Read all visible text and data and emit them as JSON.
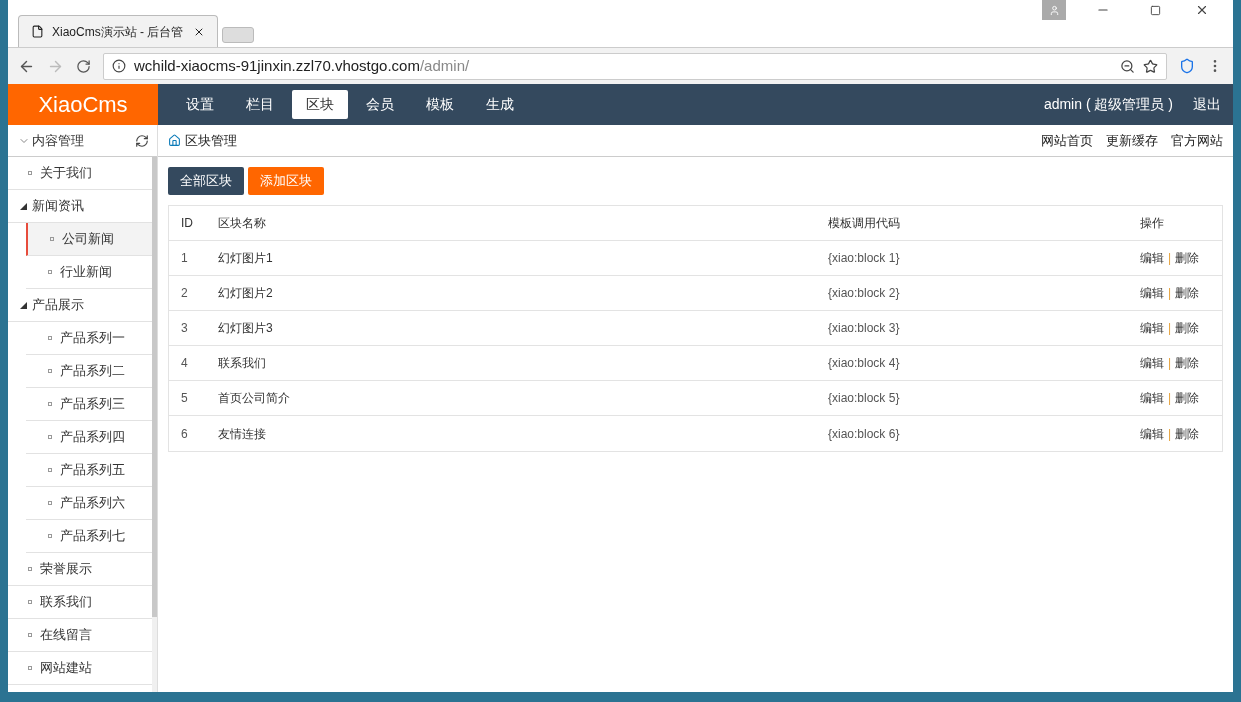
{
  "browser": {
    "tab_title": "XiaoCms演示站 - 后台管",
    "url_host": "wchild-xiaocms-91jinxin.zzl70.vhostgo.com",
    "url_path": "/admin/"
  },
  "header": {
    "logo": "XiaoCms",
    "nav": [
      {
        "label": "设置",
        "selected": false
      },
      {
        "label": "栏目",
        "selected": false
      },
      {
        "label": "区块",
        "selected": true
      },
      {
        "label": "会员",
        "selected": false
      },
      {
        "label": "模板",
        "selected": false
      },
      {
        "label": "生成",
        "selected": false
      }
    ],
    "user": "admin ( 超级管理员 )",
    "logout": "退出"
  },
  "sidebar": {
    "title": "内容管理",
    "items": [
      {
        "label": "关于我们",
        "selected": false
      },
      {
        "label": "新闻资讯",
        "selected": false,
        "expanded": true,
        "children": [
          {
            "label": "公司新闻",
            "selected": true
          },
          {
            "label": "行业新闻",
            "selected": false
          }
        ]
      },
      {
        "label": "产品展示",
        "selected": false,
        "expanded": true,
        "children": [
          {
            "label": "产品系列一",
            "selected": false
          },
          {
            "label": "产品系列二",
            "selected": false
          },
          {
            "label": "产品系列三",
            "selected": false
          },
          {
            "label": "产品系列四",
            "selected": false
          },
          {
            "label": "产品系列五",
            "selected": false
          },
          {
            "label": "产品系列六",
            "selected": false
          },
          {
            "label": "产品系列七",
            "selected": false
          }
        ]
      },
      {
        "label": "荣誉展示",
        "selected": false
      },
      {
        "label": "联系我们",
        "selected": false
      },
      {
        "label": "在线留言",
        "selected": false
      },
      {
        "label": "网站建站",
        "selected": false
      }
    ]
  },
  "breadcrumb": "区块管理",
  "top_links": [
    "网站首页",
    "更新缓存",
    "官方网站"
  ],
  "buttons": [
    {
      "label": "全部区块",
      "kind": "primary"
    },
    {
      "label": "添加区块",
      "kind": "accent"
    }
  ],
  "table": {
    "columns": [
      "ID",
      "区块名称",
      "模板调用代码",
      "操作"
    ],
    "rows": [
      {
        "id": "1",
        "name": "幻灯图片1",
        "code": "{xiao:block 1}",
        "edit": "编辑",
        "separator": "|",
        "delete": "删除"
      },
      {
        "id": "2",
        "name": "幻灯图片2",
        "code": "{xiao:block 2}",
        "edit": "编辑",
        "separator": "|",
        "delete": "删除"
      },
      {
        "id": "3",
        "name": "幻灯图片3",
        "code": "{xiao:block 3}",
        "edit": "编辑",
        "separator": "|",
        "delete": "删除"
      },
      {
        "id": "4",
        "name": "联系我们",
        "code": "{xiao:block 4}",
        "edit": "编辑",
        "separator": "|",
        "delete": "删除"
      },
      {
        "id": "5",
        "name": "首页公司简介",
        "code": "{xiao:block 5}",
        "edit": "编辑",
        "separator": "|",
        "delete": "删除"
      },
      {
        "id": "6",
        "name": "友情连接",
        "code": "{xiao:block 6}",
        "edit": "编辑",
        "separator": "|",
        "delete": "删除"
      }
    ]
  }
}
